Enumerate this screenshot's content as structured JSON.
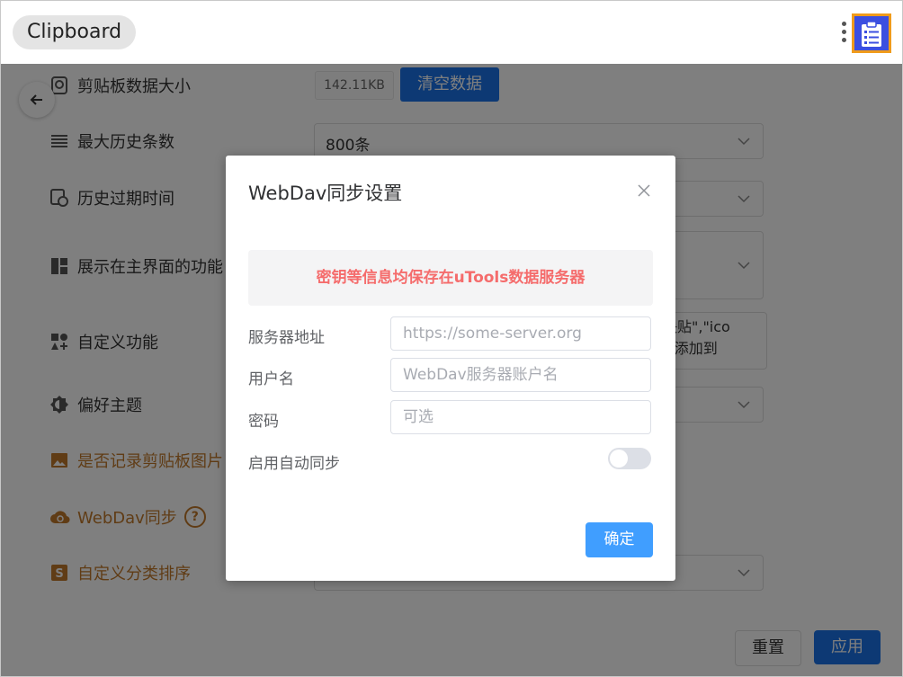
{
  "header": {
    "title": "Clipboard",
    "menu_icon": "more-vertical-icon",
    "plugin_icon": "clipboard-list-icon",
    "plugin_border_color": "#f09b1b",
    "plugin_bg_color": "#3b4fe0"
  },
  "settings": {
    "data_size": {
      "label": "剪贴板数据大小",
      "value": "142.11KB",
      "clear_label": "清空数据"
    },
    "max_history": {
      "label": "最大历史条数",
      "value": "800条"
    },
    "expire_time": {
      "label": "历史过期时间"
    },
    "main_functions": {
      "label": "展示在主界面的功能"
    },
    "custom_functions": {
      "label": "自定义功能",
      "value_line1": "快贴\",\"ico",
      "value_line2": "\":添加到"
    },
    "theme": {
      "label": "偏好主题"
    },
    "record_images": {
      "label": "是否记录剪贴板图片"
    },
    "webdav_sync": {
      "label": "WebDav同步",
      "help": "?"
    },
    "category_sort": {
      "label": "自定义分类排序"
    }
  },
  "footer": {
    "reset_label": "重置",
    "apply_label": "应用"
  },
  "dialog": {
    "title": "WebDav同步设置",
    "notice": "密钥等信息均保存在uTools数据服务器",
    "server_label": "服务器地址",
    "server_placeholder": "https://some-server.org",
    "username_label": "用户名",
    "username_placeholder": "WebDav服务器账户名",
    "password_label": "密码",
    "password_placeholder": "可选",
    "auto_sync_label": "启用自动同步",
    "auto_sync_enabled": false,
    "confirm_label": "确定"
  },
  "colors": {
    "primary": "#1a73e8",
    "dialog_primary": "#409eff",
    "warning_text": "#f56c6c",
    "accent_orange": "#c0782a"
  }
}
